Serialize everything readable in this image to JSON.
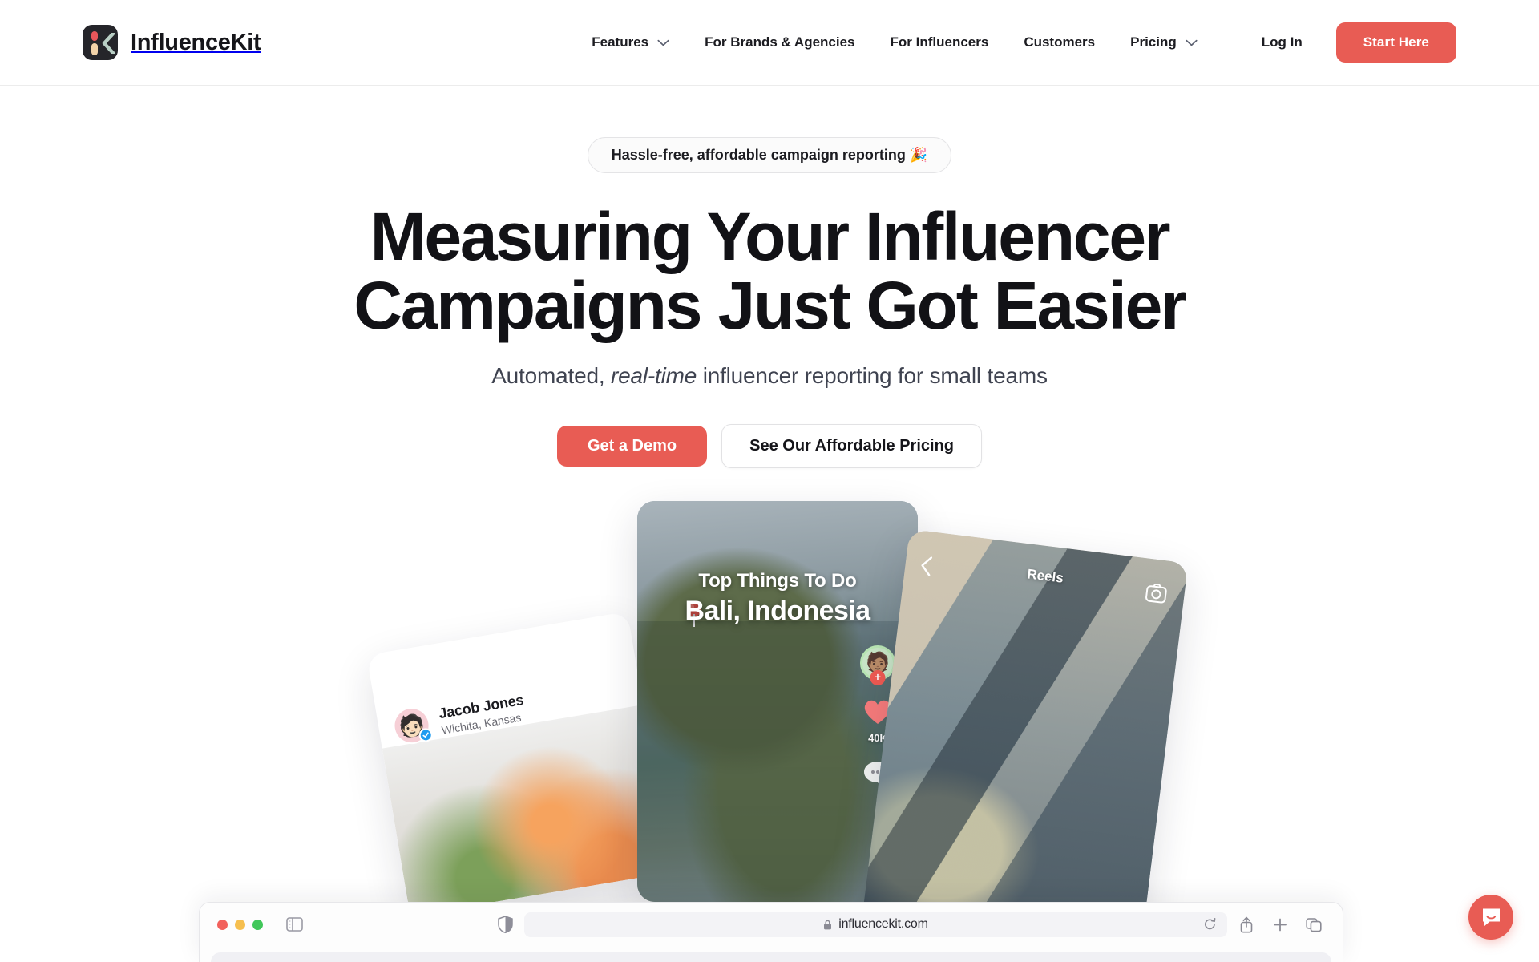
{
  "brand": {
    "name": "InfluenceKit",
    "logo_icon": "influencekit-logo-icon",
    "accent_color": "#e85c54"
  },
  "nav": {
    "items": [
      {
        "label": "Features",
        "has_dropdown": true,
        "icon": "chevron-down-icon"
      },
      {
        "label": "For Brands & Agencies",
        "has_dropdown": false
      },
      {
        "label": "For Influencers",
        "has_dropdown": false
      },
      {
        "label": "Customers",
        "has_dropdown": false
      },
      {
        "label": "Pricing",
        "has_dropdown": true,
        "icon": "chevron-down-icon"
      }
    ],
    "login_label": "Log In",
    "cta_label": "Start Here"
  },
  "hero": {
    "badge": "Hassle-free, affordable campaign reporting 🎉",
    "heading_line1": "Measuring Your Influencer",
    "heading_line2": "Campaigns Just Got Easier",
    "sub_before": "Automated, ",
    "sub_em": "real-time",
    "sub_after": " influencer reporting for small teams",
    "primary_cta": "Get a Demo",
    "secondary_cta": "See Our Affordable Pricing"
  },
  "mockups": {
    "left_card": {
      "name": "Jacob Jones",
      "location": "Wichita, Kansas",
      "avatar_icon": "memoji-avatar",
      "verified_icon": "verified-check-icon"
    },
    "center_phone": {
      "title_small": "Top Things To Do",
      "title_large": "Bali, Indonesia",
      "pin_icon": "map-pin-icon",
      "follow_icon": "plus-follow-icon",
      "like_icon": "heart-icon",
      "like_count": "40K",
      "comment_icon": "comment-bubble-icon",
      "avatar_icon": "memoji-avatar"
    },
    "right_phone": {
      "label": "Reels",
      "back_icon": "chevron-left-icon",
      "camera_icon": "camera-icon"
    }
  },
  "browser": {
    "traffic_lights": [
      "close-red",
      "minimize-yellow",
      "maximize-green"
    ],
    "sidebar_icon": "sidebar-toggle-icon",
    "shield_icon": "privacy-shield-icon",
    "lock_icon": "lock-icon",
    "url": "influencekit.com",
    "reload_icon": "reload-icon",
    "share_icon": "share-icon",
    "new_tab_icon": "plus-icon",
    "tabs_icon": "tab-overview-icon"
  },
  "chat": {
    "icon": "chat-bubble-icon",
    "color": "#e85c54"
  }
}
